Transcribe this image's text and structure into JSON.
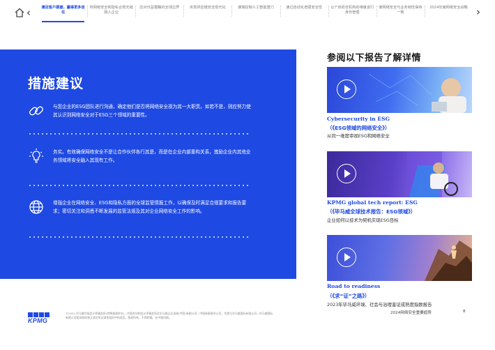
{
  "nav": {
    "tabs": [
      {
        "label": "满足客户期望，赢得更多信任",
        "active": true
      },
      {
        "label": "将网络安全和隐私合规无缝融入企业",
        "active": false
      },
      {
        "label": "应对日益模糊的全球边界",
        "active": false
      },
      {
        "label": "实现供应链安全现代化",
        "active": false
      },
      {
        "label": "谨慎控制人工智能潜力",
        "active": false
      },
      {
        "label": "通过自动化增强安全性",
        "active": false
      },
      {
        "label": "以个体而非机构的维度进行身份管理",
        "active": false
      },
      {
        "label": "使网络安全与业务韧性保持一致",
        "active": false
      },
      {
        "label": "2024年度网络安全战略",
        "active": false
      }
    ],
    "icons": {
      "home": "home-icon",
      "prev": "chevron-left-icon",
      "next": "chevron-right-icon"
    }
  },
  "panel": {
    "title": "措施建议",
    "recommendations": [
      {
        "icon": "link-chain-icon",
        "text": "与您企业的ESG团队进行沟通，确定他们是否将网络安全视为其一大职责。如若不是，则应努力使其认识到网络安全对于ESG三个领域的重要性。"
      },
      {
        "icon": "lightbulb-idea-icon",
        "text": "务实。有效确保网络安全不是让合作伙伴各行其是，而是在企业内部重构关系，激励企业内其他业务领域将安全融入其现有工作。"
      },
      {
        "icon": "globe-icon",
        "text": "增强企业在网络安全、ESG和隐私方面的全球监管情报工作，以确保及时满足合规要求和报告要求；密切关注和洞悉不断发展的监管法规及其对企业网络安全工作的影响。"
      }
    ]
  },
  "side": {
    "title": "参阅以下报告了解详情",
    "cards": [
      {
        "title": "Cybersecurity in ESG",
        "subtitle": "（《ESG领域的网络安全》）",
        "description": "从同一维度审视ESG和网络安全",
        "icon": "play-icon"
      },
      {
        "title": "KPMG global tech report: ESG",
        "subtitle": "（《毕马威全球技术报告：ESG领域》）",
        "description": "企业如何以技术为契机实现ESG目标",
        "icon": "play-icon"
      },
      {
        "title": "Road to readiness",
        "subtitle": "（《求“证”之路》）",
        "description": "2023年毕马威环境、社会与治理鉴证成熟度指数报告",
        "icon": "play-icon"
      }
    ]
  },
  "footer": {
    "logo": "KPMG",
    "legal": "©2024 毕马威华振会计师事务所(特殊普通合伙)—中国合伙制会计师事务所及毕马威企业咨询(中国)有限公司—中国有限责任公司，均是与毕马威国际有限公司—毕马威国际有限公司相关联的独立成员所全球性组织中的成员。版权所有，不得转载。在中国印刷。",
    "report_name": "2024网络安全重要趋势",
    "page_number": "8"
  },
  "colors": {
    "accent": "#1e49e2",
    "panel_text": "#ffffff"
  }
}
